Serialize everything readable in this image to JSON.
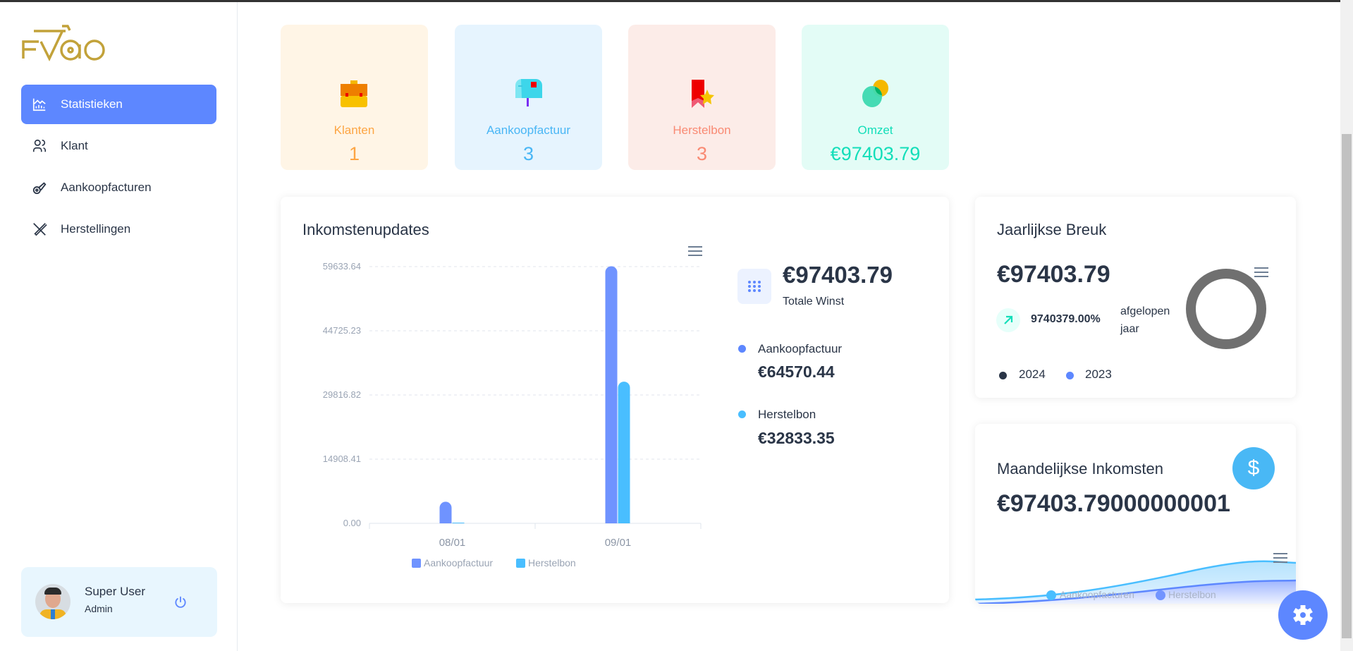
{
  "logo": {
    "text": "FVBO"
  },
  "sidebar": {
    "items": [
      {
        "label": "Statistieken",
        "icon": "chart-icon",
        "active": true
      },
      {
        "label": "Klant",
        "icon": "users-icon"
      },
      {
        "label": "Aankoopfacturen",
        "icon": "bicycle-chain-icon"
      },
      {
        "label": "Herstellingen",
        "icon": "tools-icon"
      }
    ],
    "user": {
      "name": "Super User",
      "role": "Admin"
    }
  },
  "stats": [
    {
      "label": "Klanten",
      "value": "1",
      "color": "#fda543",
      "bg": "#fff5e6"
    },
    {
      "label": "Aankoopfactuur",
      "value": "3",
      "color": "#49b6f5",
      "bg": "#e6f4fe"
    },
    {
      "label": "Herstelbon",
      "value": "3",
      "color": "#f98a73",
      "bg": "#fcece8"
    },
    {
      "label": "Omzet",
      "value": "€97403.79",
      "color": "#13deb9",
      "bg": "#e3fcf6"
    }
  ],
  "income": {
    "title": "Inkomstenupdates",
    "total": "€97403.79",
    "total_label": "Totale Winst",
    "legend": [
      {
        "label": "Aankoopfactuur",
        "value": "€64570.44",
        "color": "#5d87ff"
      },
      {
        "label": "Herstelbon",
        "value": "€32833.35",
        "color": "#49beff"
      }
    ]
  },
  "chart_data": {
    "type": "bar",
    "categories": [
      "08/01",
      "09/01"
    ],
    "series": [
      {
        "name": "Aankoopfactuur",
        "values": [
          4936.8,
          59633.64
        ],
        "color": "#6f93ff"
      },
      {
        "name": "Herstelbon",
        "values": [
          0,
          32833.35
        ],
        "color": "#49beff"
      }
    ],
    "yticks": [
      "0.00",
      "14908.41",
      "29816.82",
      "44725.23",
      "59633.64"
    ],
    "ylim": [
      0,
      59633.64
    ],
    "legend": "bottom"
  },
  "yearly": {
    "title": "Jaarlijkse Breuk",
    "value": "€97403.79",
    "percent": "9740379.00%",
    "percent_label": "afgelopen jaar",
    "legend": [
      {
        "label": "2024",
        "color": "#2a3547"
      },
      {
        "label": "2023",
        "color": "#5d87ff"
      }
    ]
  },
  "monthly": {
    "title": "Maandelijkse Inkomsten",
    "value": "€97403.79000000001",
    "legend": [
      "Aankoopfacturen",
      "Herstelbon"
    ]
  }
}
